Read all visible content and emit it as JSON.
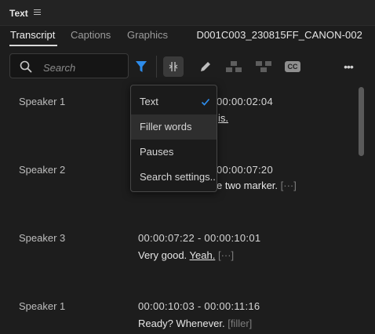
{
  "panel": {
    "title": "Text"
  },
  "tabs": [
    {
      "label": "Transcript",
      "active": true
    },
    {
      "label": "Captions",
      "active": false
    },
    {
      "label": "Graphics",
      "active": false
    }
  ],
  "clip_name": "D001C003_230815FF_CANON-002",
  "search": {
    "placeholder": "Search"
  },
  "toolbar": {
    "icons": [
      "filter-icon",
      "merge-segments-icon",
      "pencil-icon",
      "split-icon",
      "merge-icon",
      "cc-icon",
      "more-icon"
    ],
    "cc_label": "CC",
    "more_label": "•••",
    "accent": "#2d8ceb"
  },
  "filter_menu": {
    "items": [
      {
        "label": "Text",
        "checked": true
      },
      {
        "label": "Filler words",
        "checked": false
      },
      {
        "label": "Pauses",
        "checked": false
      },
      {
        "label": "Search settings..",
        "checked": false
      }
    ]
  },
  "segments": [
    {
      "speaker": "Speaker 1",
      "timecode": "00:00:02:04",
      "text": "is."
    },
    {
      "speaker": "Speaker 2",
      "timecode": "00:00:07:20",
      "text": "e two marker.",
      "tag": "[···]"
    },
    {
      "speaker": "Speaker 3",
      "timecode": "00:00:07:22 - 00:00:10:01",
      "text_plain": "Very good.",
      "text_underlined": "Yeah.",
      "tag": "[···]"
    },
    {
      "speaker": "Speaker 1",
      "timecode": "00:00:10:03 - 00:00:11:16",
      "text_plain": "Ready? Whenever.",
      "tag": "[filler]"
    }
  ]
}
